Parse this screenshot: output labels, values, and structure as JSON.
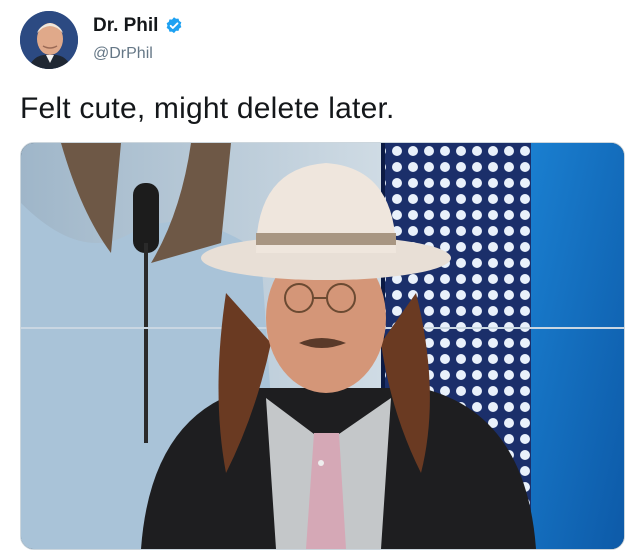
{
  "tweet": {
    "display_name": "Dr. Phil",
    "handle": "@DrPhil",
    "verified": true,
    "text": "Felt cute, might delete later.",
    "icons": {
      "verified": "verified-badge-icon",
      "avatar": "avatar-photo"
    },
    "colors": {
      "verified_blue": "#1da1f2",
      "handle_gray": "#657786",
      "text": "#14171a"
    }
  }
}
